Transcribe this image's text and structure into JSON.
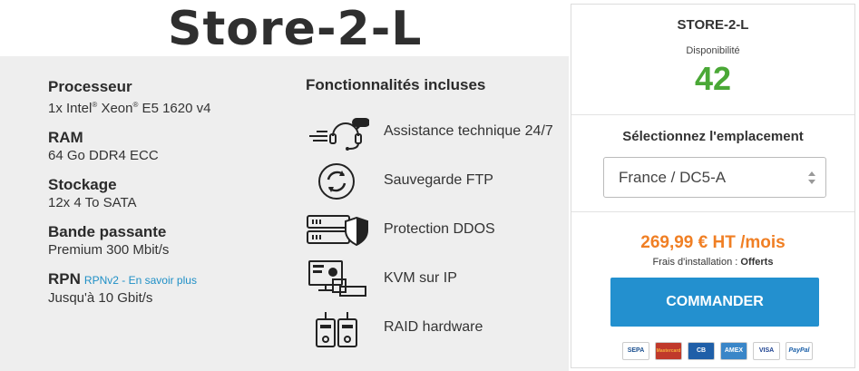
{
  "title": "Store-2-L",
  "specs": [
    {
      "label": "Processeur",
      "value_html_parts": [
        "1x Intel",
        "®",
        " Xeon",
        "®",
        " E5 1620 v4"
      ],
      "value": "1x Intel® Xeon® E5 1620 v4"
    },
    {
      "label": "RAM",
      "value": "64 Go DDR4 ECC"
    },
    {
      "label": "Stockage",
      "value": "12x 4 To SATA"
    },
    {
      "label": "Bande passante",
      "value": "Premium 300 Mbit/s"
    },
    {
      "label": "RPN",
      "link": "RPNv2 - En savoir plus",
      "value": "Jusqu'à 10 Gbit/s"
    }
  ],
  "features": {
    "title": "Fonctionnalités incluses",
    "items": [
      {
        "label": "Assistance technique 24/7",
        "icon": "headset-icon"
      },
      {
        "label": "Sauvegarde FTP",
        "icon": "sync-icon"
      },
      {
        "label": "Protection DDOS",
        "icon": "server-shield-icon"
      },
      {
        "label": "KVM sur IP",
        "icon": "kvm-icon"
      },
      {
        "label": "RAID hardware",
        "icon": "raid-disks-icon"
      }
    ]
  },
  "card": {
    "name": "STORE-2-L",
    "availability_label": "Disponibilité",
    "availability_value": "42",
    "location_title": "Sélectionnez l'emplacement",
    "location_value": "France / DC5-A",
    "price": "269,99 € HT /mois",
    "fees_label": "Frais d'installation : ",
    "fees_value": "Offerts",
    "order_label": "COMMANDER",
    "payments": [
      "SEPA",
      "Mastercard",
      "CB",
      "AMEX",
      "VISA",
      "PayPal"
    ]
  },
  "colors": {
    "availability": "#4aa836",
    "price": "#f07f24",
    "button": "#2390cf",
    "link": "#1e8fc6"
  }
}
